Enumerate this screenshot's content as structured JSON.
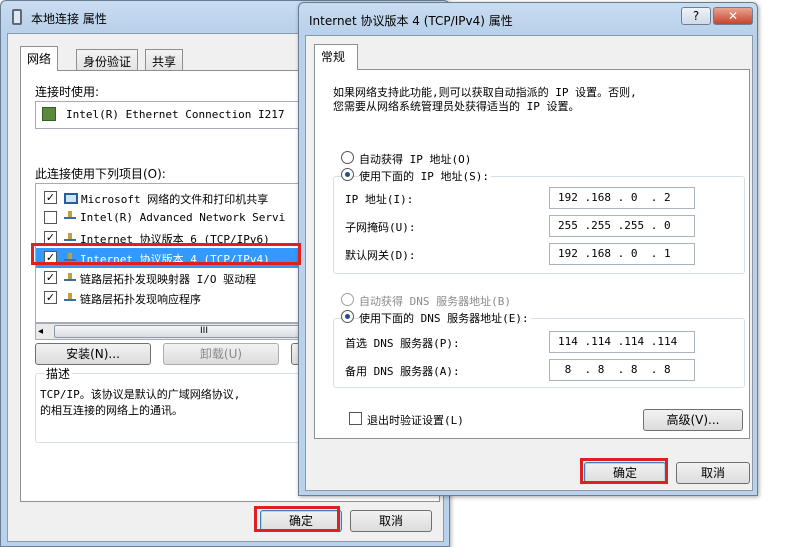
{
  "back_window": {
    "title": "本地连接 属性",
    "tabs": [
      "网络",
      "身份验证",
      "共享"
    ],
    "connect_using_label": "连接时使用:",
    "adapter_name": "Intel(R) Ethernet Connection I217",
    "items_label": "此连接使用下列项目(O):",
    "items": [
      {
        "label": "Microsoft 网络的文件和打印机共享",
        "checked": true,
        "icon": "computer-icon"
      },
      {
        "label": "Intel(R) Advanced Network Servi",
        "checked": false,
        "icon": "network-protocol-icon"
      },
      {
        "label": "Internet 协议版本 6 (TCP/IPv6)",
        "checked": true,
        "icon": "network-protocol-icon"
      },
      {
        "label": "Internet 协议版本 4 (TCP/IPv4)",
        "checked": true,
        "icon": "network-protocol-icon"
      },
      {
        "label": "链路层拓扑发现映射器 I/O 驱动程",
        "checked": true,
        "icon": "network-protocol-icon"
      },
      {
        "label": "链路层拓扑发现响应程序",
        "checked": true,
        "icon": "network-protocol-icon"
      }
    ],
    "scroll_thumb": "III",
    "install_button": "安装(N)...",
    "uninstall_button": "卸载(U)",
    "description_title": "描述",
    "description_text_1": "TCP/IP。该协议是默认的广域网络协议,",
    "description_text_2": "的相互连接的网络上的通讯。",
    "ok_button": "确定",
    "cancel_button": "取消"
  },
  "front_window": {
    "title": "Internet 协议版本 4 (TCP/IPv4) 属性",
    "help_button": "?",
    "close_button": "✕",
    "tab": "常规",
    "intro_line_1": "如果网络支持此功能,则可以获取自动指派的 IP 设置。否则,",
    "intro_line_2": "您需要从网络系统管理员处获得适当的 IP 设置。",
    "auto_ip_label": "自动获得 IP 地址(O)",
    "manual_ip_label": "使用下面的 IP 地址(S):",
    "ip_label": "IP 地址(I):",
    "ip_value": "192 .168 . 0  . 2",
    "mask_label": "子网掩码(U):",
    "mask_value": "255 .255 .255 . 0",
    "gateway_label": "默认网关(D):",
    "gateway_value": "192 .168 . 0  . 1",
    "auto_dns_label": "自动获得 DNS 服务器地址(B)",
    "manual_dns_label": "使用下面的 DNS 服务器地址(E):",
    "preferred_dns_label": "首选 DNS 服务器(P):",
    "preferred_dns_value": "114 .114 .114 .114",
    "alternate_dns_label": "备用 DNS 服务器(A):",
    "alternate_dns_value": " 8  . 8  . 8  . 8",
    "validate_label": "退出时验证设置(L)",
    "advanced_button": "高级(V)...",
    "ok_button": "确定",
    "cancel_button": "取消"
  },
  "colors": {
    "highlight_box": "#e02020",
    "title_gradient": "#b9d1ea"
  }
}
